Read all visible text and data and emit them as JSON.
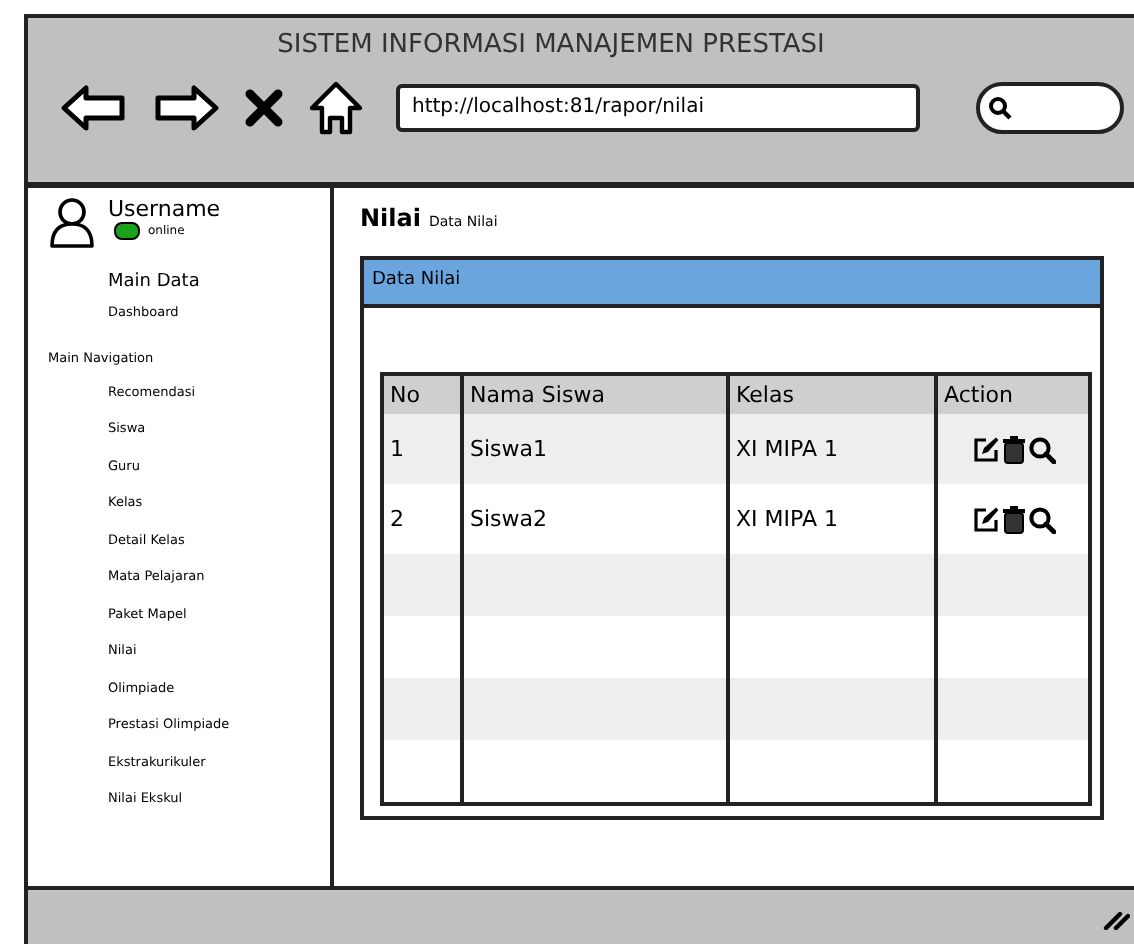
{
  "window": {
    "title": "SISTEM INFORMASI MANAJEMEN PRESTASI"
  },
  "browser": {
    "url": "http://localhost:81/rapor/nilai"
  },
  "user": {
    "name": "Username",
    "status": "online"
  },
  "sidebar": {
    "sections": [
      {
        "label": "Main Data",
        "heading": false,
        "items": [
          "Dashboard"
        ]
      },
      {
        "label": "Main Navigation",
        "heading": true,
        "items": [
          "Recomendasi",
          "Siswa",
          "Guru",
          "Kelas",
          "Detail Kelas",
          "Mata Pelajaran",
          "Paket Mapel",
          "Nilai",
          "Olimpiade",
          "Prestasi Olimpiade",
          "Ekstrakurikuler",
          "Nilai Ekskul"
        ]
      }
    ]
  },
  "page": {
    "title": "Nilai",
    "subtitle": "Data Nilai"
  },
  "panel": {
    "title": "Data Nilai"
  },
  "table": {
    "columns": [
      "No",
      "Nama Siswa",
      "Kelas",
      "Action"
    ],
    "rows": [
      {
        "no": "1",
        "name": "Siswa1",
        "kelas": "XI MIPA 1"
      },
      {
        "no": "2",
        "name": "Siswa2",
        "kelas": "XI MIPA 1"
      }
    ]
  }
}
